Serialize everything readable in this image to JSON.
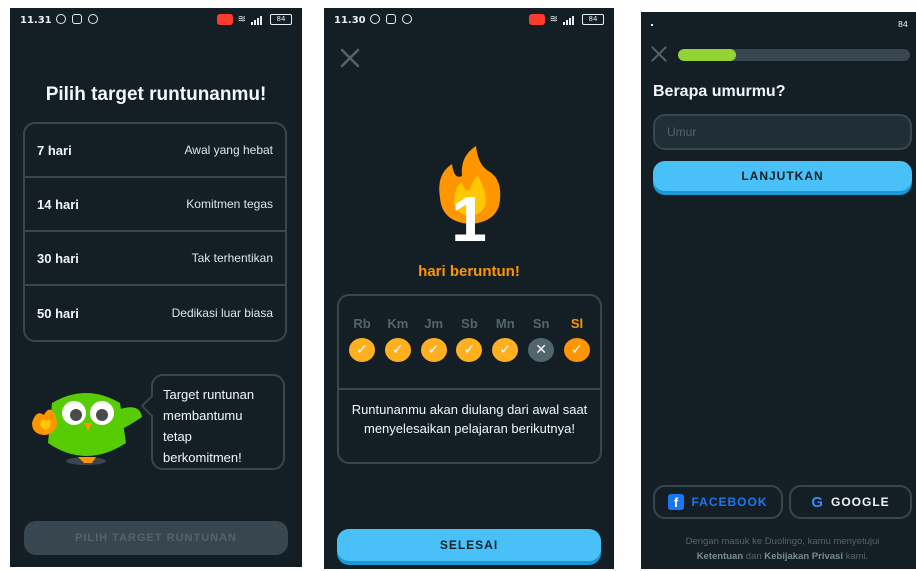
{
  "screen1": {
    "status_time": "11.31",
    "battery": "84",
    "title": "Pilih target runtunanmu!",
    "options": [
      {
        "days": "7 hari",
        "label": "Awal yang hebat"
      },
      {
        "days": "14 hari",
        "label": "Komitmen tegas"
      },
      {
        "days": "30 hari",
        "label": "Tak terhentikan"
      },
      {
        "days": "50 hari",
        "label": "Dedikasi luar biasa"
      }
    ],
    "bubble_lines": [
      "Target runtunan",
      "membantumu",
      "tetap",
      "berkomitmen!"
    ],
    "button_label": "PILIH TARGET RUNTUNAN"
  },
  "screen2": {
    "status_time": "11.30",
    "battery": "84",
    "streak_number": "1",
    "streak_label": "hari beruntun!",
    "days": [
      "Rb",
      "Km",
      "Jm",
      "Sb",
      "Mn",
      "Sn",
      "Sl"
    ],
    "day_status": [
      "done",
      "done",
      "done",
      "done",
      "done",
      "missed",
      "today"
    ],
    "message": "Runtunanmu akan diulang dari awal saat menyelesaikan pelajaran berikutnya!",
    "button_label": "SELESAI"
  },
  "screen3": {
    "battery": "84",
    "progress_fraction": 0.25,
    "title": "Berapa umurmu?",
    "input_placeholder": "Umur",
    "continue_label": "LANJUTKAN",
    "facebook_label": "FACEBOOK",
    "google_label": "GOOGLE",
    "terms_prefix": "Dengan masuk ke Duolingo, kamu menyetujui",
    "terms_link1": "Ketentuan",
    "terms_and": "dan",
    "terms_link2": "Kebijakan Privasi",
    "terms_suffix": "kami."
  },
  "colors": {
    "background": "#131f24",
    "border": "#37464f",
    "accent_blue": "#49c0f8",
    "streak_orange": "#ff9600",
    "progress_green": "#93d333",
    "facebook_blue": "#1877f2"
  }
}
